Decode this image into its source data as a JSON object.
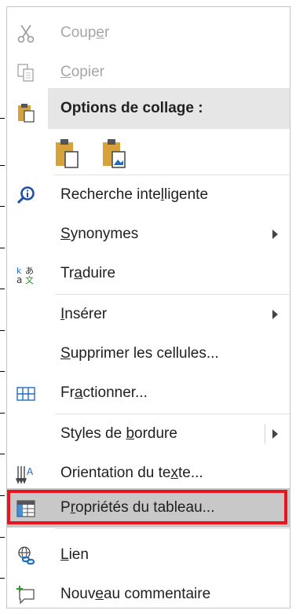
{
  "menu": {
    "items": [
      {
        "label_parts": [
          "Coup",
          "e",
          "r"
        ],
        "icon": "scissors-icon",
        "disabled": true
      },
      {
        "label_parts": [
          "",
          "C",
          "opier"
        ],
        "icon": "copy-icon",
        "disabled": true
      },
      {
        "label_parts": [
          "Options de collage :",
          "",
          ""
        ],
        "icon": "paste-icon"
      },
      {
        "label_parts": [
          "Recherche inte",
          "l",
          "ligente"
        ],
        "icon": "smart-lookup-icon"
      },
      {
        "label_parts": [
          "",
          "S",
          "ynonymes"
        ],
        "icon": null,
        "submenu": true
      },
      {
        "label_parts": [
          "Tr",
          "a",
          "duire"
        ],
        "icon": "translate-icon"
      },
      {
        "label_parts": [
          "",
          "I",
          "nsérer"
        ],
        "icon": null,
        "submenu": true
      },
      {
        "label_parts": [
          "",
          "S",
          "upprimer les cellules..."
        ],
        "icon": null
      },
      {
        "label_parts": [
          "Fr",
          "a",
          "ctionner..."
        ],
        "icon": "split-cells-icon"
      },
      {
        "label_parts": [
          "Styles de ",
          "b",
          "ordure"
        ],
        "icon": null,
        "submenu": true
      },
      {
        "label_parts": [
          "Orientation du te",
          "x",
          "te..."
        ],
        "icon": "text-direction-icon"
      },
      {
        "label_parts": [
          "P",
          "r",
          "opriétés du tableau..."
        ],
        "icon": "table-properties-icon",
        "highlighted": true
      },
      {
        "label_parts": [
          "",
          "L",
          "ien"
        ],
        "icon": "link-icon"
      },
      {
        "label_parts": [
          "Nouv",
          "e",
          "au commentaire"
        ],
        "icon": "new-comment-icon"
      }
    ]
  },
  "colors": {
    "highlight": "#c8c8c8",
    "annotation_red": "#e8141e",
    "paste_header_bg": "#e6e6e6",
    "icon_gold": "#d8a23a",
    "icon_blue": "#1e6fbf"
  }
}
